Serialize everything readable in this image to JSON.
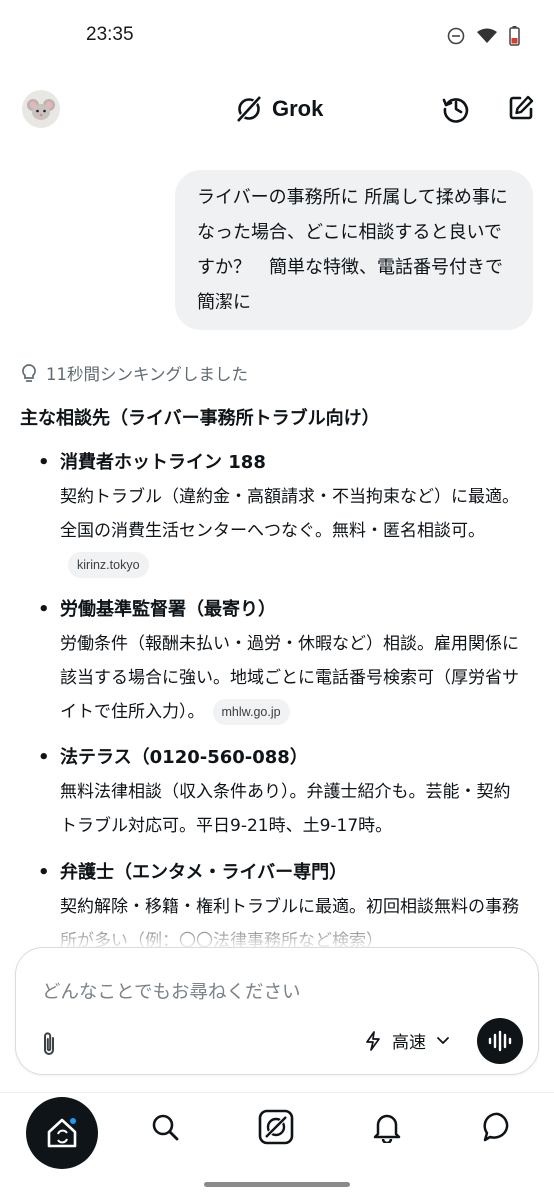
{
  "status": {
    "time": "23:35"
  },
  "header": {
    "brand": "Grok"
  },
  "user_message": "ライバーの事務所に 所属して揉め事になった場合、どこに相談すると良いですか？　簡単な特徴、電話番号付きで　簡潔に",
  "thinking": "11秒間シンキングしました",
  "answer": {
    "title": "主な相談先（ライバー事務所トラブル向け）",
    "items": [
      {
        "title": "消費者ホットライン 188",
        "body": "契約トラブル（違約金・高額請求・不当拘束など）に最適。全国の消費生活センターへつなぐ。無料・匿名相談可。",
        "source": "kirinz.tokyo"
      },
      {
        "title": "労働基準監督署（最寄り）",
        "body": "労働条件（報酬未払い・過労・休暇など）相談。雇用関係に該当する場合に強い。地域ごとに電話番号検索可（厚労省サイトで住所入力）。",
        "source": "mhlw.go.jp"
      },
      {
        "title": "法テラス（0120-560-088）",
        "body": "無料法律相談（収入条件あり）。弁護士紹介も。芸能・契約トラブル対応可。平日9-21時、土9-17時。",
        "source": ""
      },
      {
        "title": "弁護士（エンタメ・ライバー専門）",
        "body": "契約解除・移籍・権利トラブルに最適。初回相談無料の事務所が多い（例：〇〇法律事務所など検索）",
        "source": ""
      }
    ]
  },
  "composer": {
    "placeholder": "どんなことでもお尋ねください",
    "mode": "高速"
  },
  "icons": {
    "avatar": "mouse-avatar-icon",
    "logo": "grok-logo-icon",
    "history": "history-icon",
    "new_chat": "new-chat-icon",
    "thinking": "lightbulb-icon",
    "attach": "paperclip-icon",
    "mode": "lightning-icon",
    "mode_caret": "chevron-down-icon",
    "voice": "voice-waveform-icon",
    "nav": [
      "home-icon",
      "search-icon",
      "grok-icon",
      "bell-icon",
      "chat-icon"
    ]
  }
}
